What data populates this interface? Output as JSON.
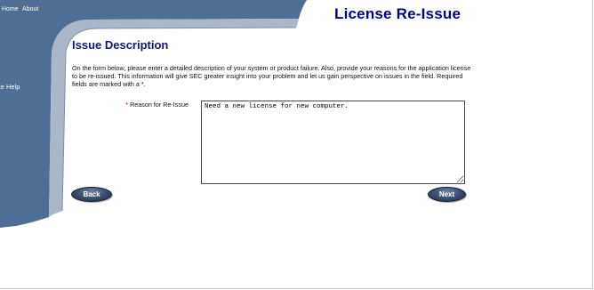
{
  "nav": {
    "home": "Home",
    "about": "About",
    "site_help": "Site Help"
  },
  "header": {
    "title": "License Re-Issue"
  },
  "section": {
    "title": "Issue Description",
    "description": "On the form below, please enter a detailed description of your system or product failure. Also, provide your reasons for the application license to be re-issued. This information will give SEC greater insight into your problem and let us gain perspective on issues in the field. Required fields are marked with a *."
  },
  "form": {
    "reason_label_star": "*",
    "reason_label": " Reason for Re-Issue",
    "reason_value": "Need a new license for new computer."
  },
  "buttons": {
    "back": "Back",
    "next": "Next"
  },
  "colors": {
    "chrome": "#4f6e94",
    "chrome_light": "#7d95b3",
    "title": "#00008b"
  }
}
